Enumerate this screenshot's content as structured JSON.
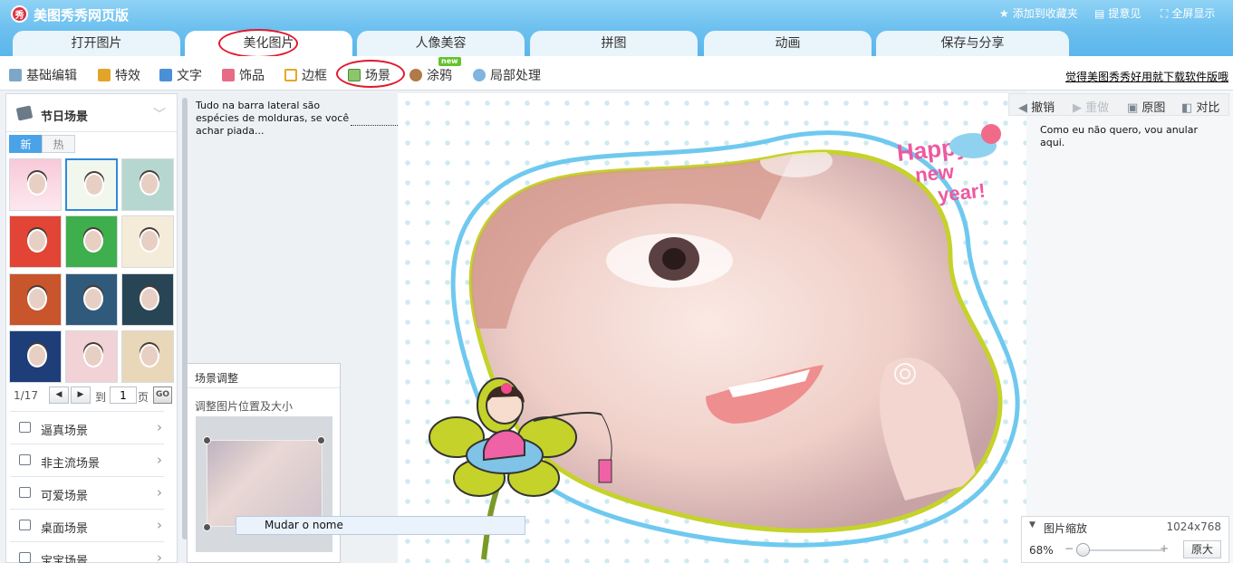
{
  "app": {
    "title": "美图秀秀网页版",
    "logo_text": "秀",
    "links": [
      {
        "label": "添加到收藏夹",
        "icon": "star-icon"
      },
      {
        "label": "提意见",
        "icon": "comment-icon"
      },
      {
        "label": "全屏显示",
        "icon": "fullscreen-icon"
      }
    ]
  },
  "tabs": [
    {
      "label": "打开图片"
    },
    {
      "label": "美化图片",
      "active": true
    },
    {
      "label": "人像美容"
    },
    {
      "label": "拼图"
    },
    {
      "label": "动画"
    },
    {
      "label": "保存与分享"
    }
  ],
  "toolbar": {
    "items": [
      {
        "label": "基础编辑",
        "icon": "basic-edit-icon"
      },
      {
        "label": "特效",
        "icon": "magic-wand-icon"
      },
      {
        "label": "文字",
        "icon": "text-icon"
      },
      {
        "label": "饰品",
        "icon": "bow-icon"
      },
      {
        "label": "边框",
        "icon": "frame-icon"
      },
      {
        "label": "场景",
        "icon": "scene-icon"
      },
      {
        "label": "涂鸦",
        "icon": "brush-icon"
      },
      {
        "label": "局部处理",
        "icon": "local-process-icon"
      }
    ],
    "new_badge": "new",
    "download_link": "觉得美图秀秀好用就下载软件版哦"
  },
  "sidebar": {
    "title": "节日场景",
    "tab_new": "新",
    "tab_hot": "热",
    "pager": {
      "count": "1/17",
      "to": "到",
      "page_value": "1",
      "page": "页",
      "go": "GO"
    },
    "categories": [
      {
        "label": "逼真场景"
      },
      {
        "label": "非主流场景"
      },
      {
        "label": "可爱场景"
      },
      {
        "label": "桌面场景"
      },
      {
        "label": "宝宝场景"
      }
    ]
  },
  "hint_text": "Tudo na barra lateral são espécies de molduras, se você achar piada...",
  "adjust_panel": {
    "title": "场景调整",
    "subtitle": "调整图片位置及大小"
  },
  "rename_tooltip": "Mudar o nome",
  "actions": {
    "undo": "撤销",
    "redo": "重做",
    "original": "原图",
    "compare": "对比"
  },
  "annotation": "Como eu não quero, vou anular aqui.",
  "zoom": {
    "label": "图片缩放",
    "dimensions": "1024x768",
    "percent": "68%",
    "percent_value": 0.68,
    "button": "原大"
  },
  "canvas": {
    "text_line1": "Happy",
    "text_line2": "new",
    "text_line3": "year!"
  },
  "colors": {
    "accent": "#5ab6ea",
    "annotation_red": "#e0192e",
    "frame_blue": "#6fc9ef",
    "frame_green": "#c5d22a",
    "text_pink": "#ec5aa0"
  }
}
